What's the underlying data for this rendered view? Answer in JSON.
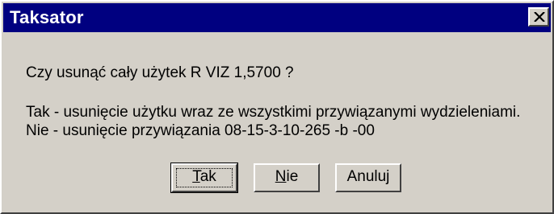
{
  "window": {
    "title": "Taksator",
    "close_icon": "close-x-icon"
  },
  "message": {
    "question": "Czy usunąć cały użytek R VIZ 1,5700 ?",
    "line1": "Tak - usunięcie użytku wraz ze wszystkimi przywiązanymi wydzieleniami.",
    "line2": "Nie - usunięcie przywiązania 08-15-3-10-265 -b -00"
  },
  "buttons": {
    "yes": {
      "mnemonic": "T",
      "rest": "ak"
    },
    "no": {
      "mnemonic": "N",
      "rest": "ie"
    },
    "cancel": {
      "label": "Anuluj"
    }
  },
  "colors": {
    "titlebar": "#000080",
    "face": "#d4d0c8"
  }
}
